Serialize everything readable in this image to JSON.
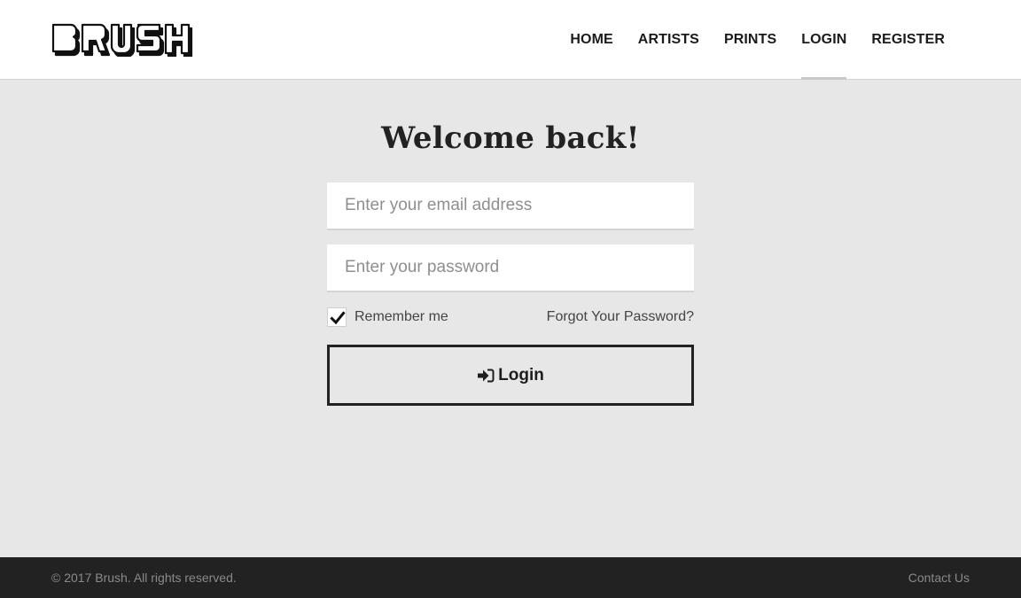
{
  "brand": {
    "logo_text": "BRUSH"
  },
  "nav": {
    "items": [
      {
        "label": "HOME"
      },
      {
        "label": "ARTISTS"
      },
      {
        "label": "PRINTS"
      },
      {
        "label": "LOGIN",
        "active": true
      },
      {
        "label": "REGISTER"
      }
    ]
  },
  "login": {
    "title": "Welcome back!",
    "email_placeholder": "Enter your email address",
    "password_placeholder": "Enter your password",
    "remember_label": "Remember me",
    "remember_checked": true,
    "forgot_label": "Forgot Your Password?",
    "button_label": "Login",
    "button_icon": "sign-in-icon"
  },
  "footer": {
    "copyright": "© 2017 Brush. All rights reserved.",
    "contact_label": "Contact Us"
  },
  "colors": {
    "page_bg": "#e7e7e7",
    "header_bg": "#ffffff",
    "footer_bg": "#222222",
    "text_dark": "#1b1b1b",
    "active_underline": "#c8c8c8"
  }
}
